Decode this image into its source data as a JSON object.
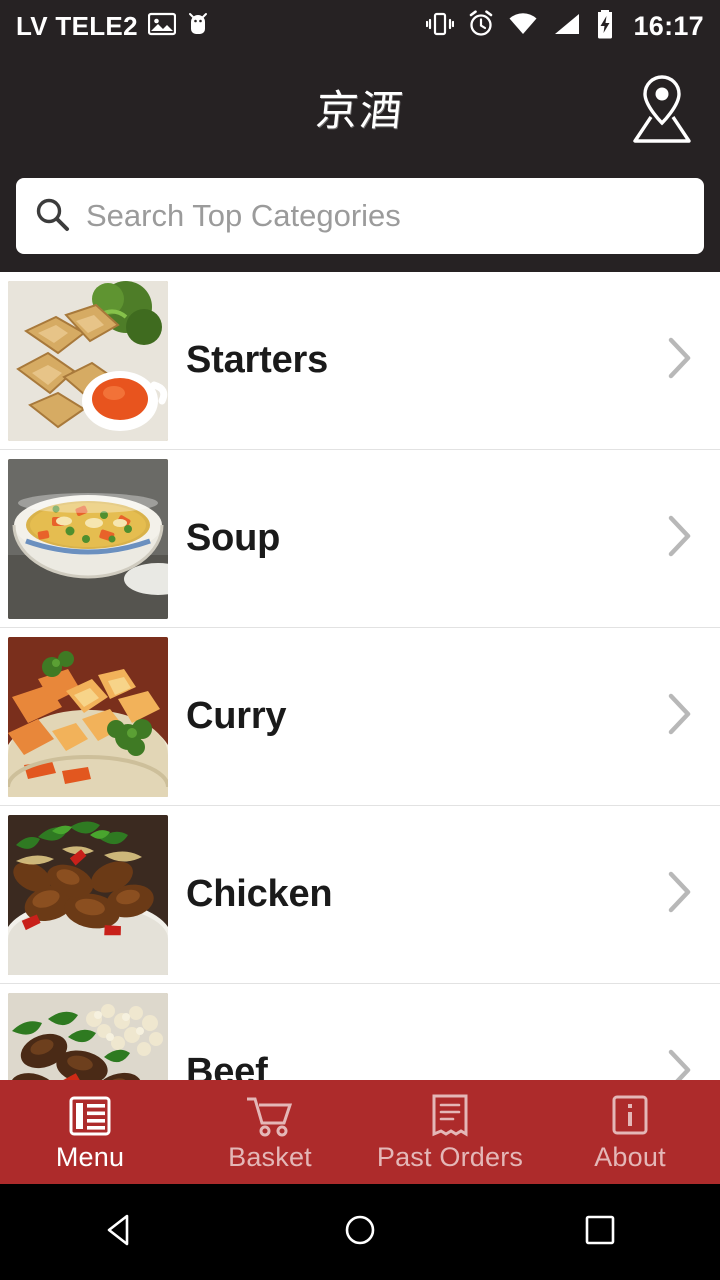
{
  "status_bar": {
    "carrier": "LV TELE2",
    "time": "16:17",
    "icons": [
      "image-icon",
      "bug-droid-icon",
      "vibrate-icon",
      "alarm-clock-icon",
      "wifi-icon",
      "signal-icon",
      "battery-charging-icon"
    ]
  },
  "header": {
    "logo_text": "京酒",
    "logo_name": "restaurant-logo",
    "location_icon": "location-pin-icon"
  },
  "search": {
    "placeholder": "Search Top Categories",
    "value": "",
    "icon": "search-icon"
  },
  "categories": [
    {
      "label": "Starters",
      "thumb": "starters-thumbnail",
      "chevron": "chevron-right-icon"
    },
    {
      "label": "Soup",
      "thumb": "soup-thumbnail",
      "chevron": "chevron-right-icon"
    },
    {
      "label": "Curry",
      "thumb": "curry-thumbnail",
      "chevron": "chevron-right-icon"
    },
    {
      "label": "Chicken",
      "thumb": "chicken-thumbnail",
      "chevron": "chevron-right-icon"
    },
    {
      "label": "Beef",
      "thumb": "beef-thumbnail",
      "chevron": "chevron-right-icon"
    }
  ],
  "bottom_nav": {
    "active_index": 0,
    "items": [
      {
        "label": "Menu",
        "icon": "menu-list-icon"
      },
      {
        "label": "Basket",
        "icon": "shopping-cart-icon"
      },
      {
        "label": "Past Orders",
        "icon": "receipt-icon"
      },
      {
        "label": "About",
        "icon": "info-icon"
      }
    ]
  },
  "system_nav": {
    "back": "back-triangle-icon",
    "home": "home-circle-icon",
    "recents": "recents-square-icon"
  },
  "colors": {
    "header_bg": "#262223",
    "nav_bg": "#ad2b2b",
    "nav_active": "#ffffff",
    "nav_inactive": "#e4b7b7",
    "page_bg": "#ffffff",
    "text": "#1a1a1a",
    "placeholder": "#9b9b9b"
  }
}
